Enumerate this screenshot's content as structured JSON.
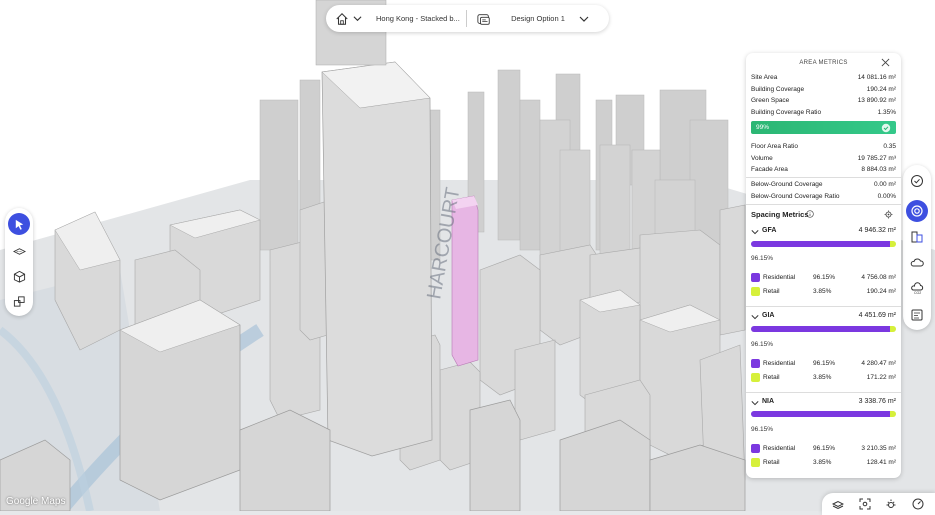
{
  "topbar": {
    "project_name": "Hong Kong - Stacked b...",
    "option_name": "Design Option 1"
  },
  "map": {
    "attribution": "Google Maps"
  },
  "colors": {
    "accent": "#3d4fe0",
    "residential": "#7b38e0",
    "retail": "#d6f03a",
    "coverage_ok": "#2bb673"
  },
  "panel": {
    "title": "AREA METRICS",
    "rows1": [
      {
        "label": "Site Area",
        "value": "14 081.16 m²"
      },
      {
        "label": "Building Coverage",
        "value": "190.24 m²"
      },
      {
        "label": "Green Space",
        "value": "13 890.92 m²"
      },
      {
        "label": "Building Coverage Ratio",
        "value": "1.35%"
      }
    ],
    "coverage_bar": {
      "label": "99%",
      "fraction": 0.99
    },
    "rows2": [
      {
        "label": "Floor Area Ratio",
        "value": "0.35"
      },
      {
        "label": "Volume",
        "value": "19 785.27 m³"
      },
      {
        "label": "Facade Area",
        "value": "8 884.03 m²"
      }
    ],
    "rows3": [
      {
        "label": "Below-Ground Coverage",
        "value": "0.00 m²"
      },
      {
        "label": "Below-Ground Coverage Ratio",
        "value": "0.00%"
      }
    ],
    "spacing_title": "Spacing Metrics",
    "sections": [
      {
        "name": "GFA",
        "total": "4 946.32 m²",
        "percent": "96.15%",
        "residential_fraction": 0.9615,
        "items": [
          {
            "name": "Residential",
            "pct": "96.15%",
            "value": "4 756.08 m²"
          },
          {
            "name": "Retail",
            "pct": "3.85%",
            "value": "190.24 m²"
          }
        ]
      },
      {
        "name": "GIA",
        "total": "4 451.69 m²",
        "percent": "96.15%",
        "residential_fraction": 0.9615,
        "items": [
          {
            "name": "Residential",
            "pct": "96.15%",
            "value": "4 280.47 m²"
          },
          {
            "name": "Retail",
            "pct": "3.85%",
            "value": "171.22 m²"
          }
        ]
      },
      {
        "name": "NIA",
        "total": "3 338.76 m²",
        "percent": "96.15%",
        "residential_fraction": 0.9615,
        "items": [
          {
            "name": "Residential",
            "pct": "96.15%",
            "value": "3 210.35 m²"
          },
          {
            "name": "Retail",
            "pct": "3.85%",
            "value": "128.41 m²"
          }
        ]
      }
    ]
  },
  "icons": {
    "left": [
      "select-icon",
      "plane-icon",
      "box-icon",
      "boxes-icon"
    ],
    "right": [
      "check-circle-icon",
      "sun-dial-icon",
      "massing-icon",
      "cloud-icon",
      "co2-icon",
      "report-icon"
    ],
    "bottom": [
      "layers-icon",
      "focus-icon",
      "sun-icon",
      "compass-icon"
    ]
  }
}
